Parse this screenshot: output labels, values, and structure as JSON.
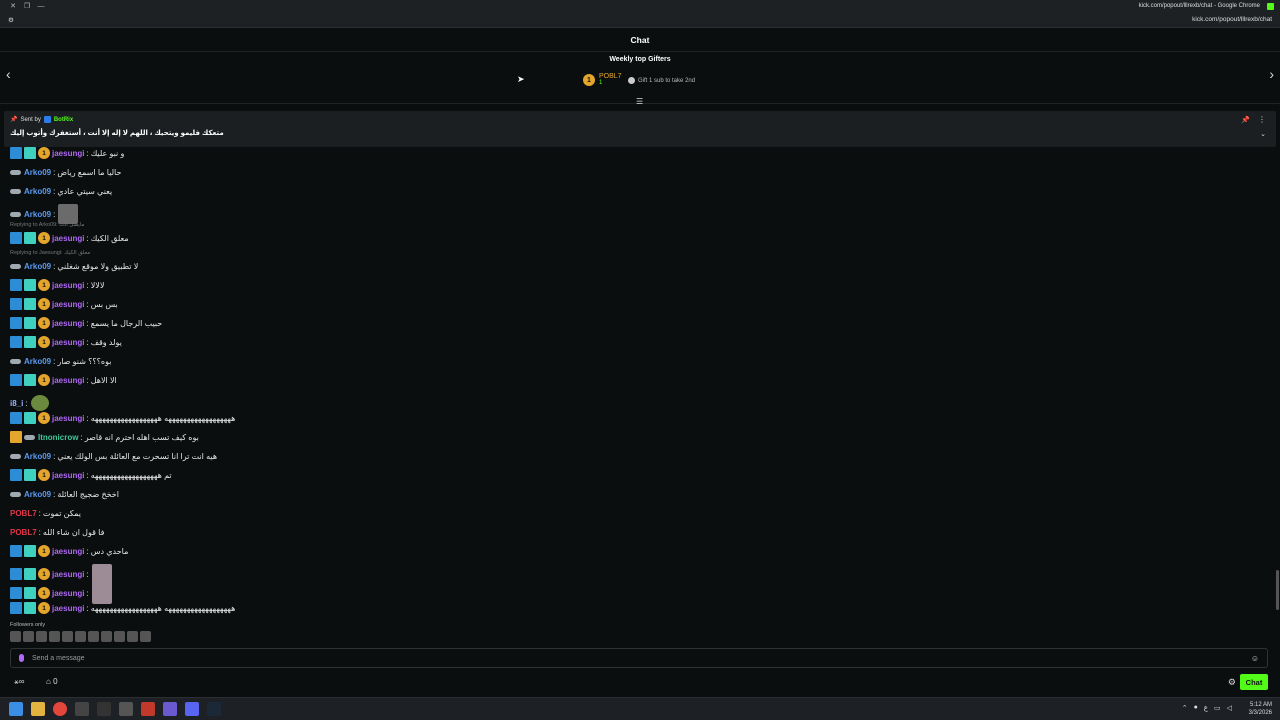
{
  "window": {
    "title": "kick.com/popout/lllrexb/chat - Google Chrome",
    "url": "kick.com/popout/lllrexb/chat"
  },
  "header": {
    "title": "Chat"
  },
  "gifters": {
    "title": "Weekly top Gifters",
    "top_name": "POBL7",
    "top_count": "1",
    "hint": "Gift 1 sub to take 2nd",
    "rank_badge": "1"
  },
  "pinned": {
    "sent_by": "Sent by",
    "bot_name": "BotRix",
    "message": "متعكك فليمو ويتحيك ، اللهم لا إله إلا أنت ، أستغفرك وأتوب إليك"
  },
  "messages": [
    {
      "user": "jaesungi",
      "text": "و نبو عليك",
      "badges": [
        "mod",
        "og",
        "sub"
      ],
      "color": "purple"
    },
    {
      "user": "Arko09",
      "text": "حاليا ما اسمع رياض",
      "badges": [
        "car"
      ],
      "color": "blue"
    },
    {
      "user": "Arko09",
      "text": "يعني سيتي عادي",
      "badges": [
        "car"
      ],
      "color": "blue"
    },
    {
      "user": "Arko09",
      "text": "",
      "badges": [
        "car"
      ],
      "color": "blue",
      "emote": "image"
    },
    {
      "reply": "Replying to Arko09: مايصل الت"
    },
    {
      "user": "jaesungi",
      "text": "معلق الكيك",
      "badges": [
        "mod",
        "og",
        "sub"
      ],
      "color": "purple"
    },
    {
      "reply": "Replying to Jaesungi: معلق الكيك"
    },
    {
      "user": "Arko09",
      "text": "لا تطبيق ولا موقع شغلني",
      "badges": [
        "car"
      ],
      "color": "blue"
    },
    {
      "user": "jaesungi",
      "text": "لالالا",
      "badges": [
        "mod",
        "og",
        "sub"
      ],
      "color": "purple"
    },
    {
      "user": "jaesungi",
      "text": "بس بس",
      "badges": [
        "mod",
        "og",
        "sub"
      ],
      "color": "purple"
    },
    {
      "user": "jaesungi",
      "text": "حبيب الرجال ما يسمع",
      "badges": [
        "mod",
        "og",
        "sub"
      ],
      "color": "purple"
    },
    {
      "user": "jaesungi",
      "text": "يولد وقف",
      "badges": [
        "mod",
        "og",
        "sub"
      ],
      "color": "purple"
    },
    {
      "user": "Arko09",
      "text": "بوه؟؟؟ شنو صار",
      "badges": [
        "car"
      ],
      "color": "blue"
    },
    {
      "user": "jaesungi",
      "text": "الا الاهل",
      "badges": [
        "mod",
        "og",
        "sub"
      ],
      "color": "purple"
    },
    {
      "user": "i8_i",
      "text": "",
      "badges": [],
      "color": "lblue",
      "emote": "frog"
    },
    {
      "user": "jaesungi",
      "text": "ههههههههههههههههههه ههههههههههههههههههه",
      "badges": [
        "mod",
        "og",
        "sub"
      ],
      "color": "purple"
    },
    {
      "user": "Itnonicrow",
      "text": "بوه كيف تسب اهله احترم انه قاصر",
      "badges": [
        "crown",
        "car"
      ],
      "color": "green"
    },
    {
      "user": "Arko09",
      "text": "هيه انت ترا انا تسحرت مع العائلة بس الولك يعني",
      "badges": [
        "car"
      ],
      "color": "blue"
    },
    {
      "user": "jaesungi",
      "text": "تم ههههههههههههههههههه",
      "badges": [
        "mod",
        "og",
        "sub"
      ],
      "color": "purple"
    },
    {
      "user": "Arko09",
      "text": "اخخخ ضجيج العائلة",
      "badges": [
        "car"
      ],
      "color": "blue"
    },
    {
      "user": "POBL7",
      "text": "يمكن تموت",
      "badges": [],
      "color": "red"
    },
    {
      "user": "POBL7",
      "text": "فا قول ان شاء الله",
      "badges": [],
      "color": "red"
    },
    {
      "user": "jaesungi",
      "text": "ماحدي دس",
      "badges": [
        "mod",
        "og",
        "sub"
      ],
      "color": "purple"
    },
    {
      "user": "jaesungi",
      "text": "",
      "badges": [
        "mod",
        "og",
        "sub"
      ],
      "color": "purple",
      "emote": "big"
    },
    {
      "user": "jaesungi",
      "text": "",
      "badges": [
        "mod",
        "og",
        "sub"
      ],
      "color": "purple",
      "emote": "big"
    },
    {
      "user": "jaesungi",
      "text": "ههههههههههههههههههه ههههههههههههههههههه",
      "badges": [
        "mod",
        "og",
        "sub"
      ],
      "color": "purple"
    }
  ],
  "footer": {
    "followers_only": "Followers only",
    "placeholder": "Send a message",
    "chat_button": "Chat",
    "count": "0",
    "sub_badge": "1"
  },
  "tray": {
    "time": "5:12 AM",
    "date": "3/3/2026"
  }
}
